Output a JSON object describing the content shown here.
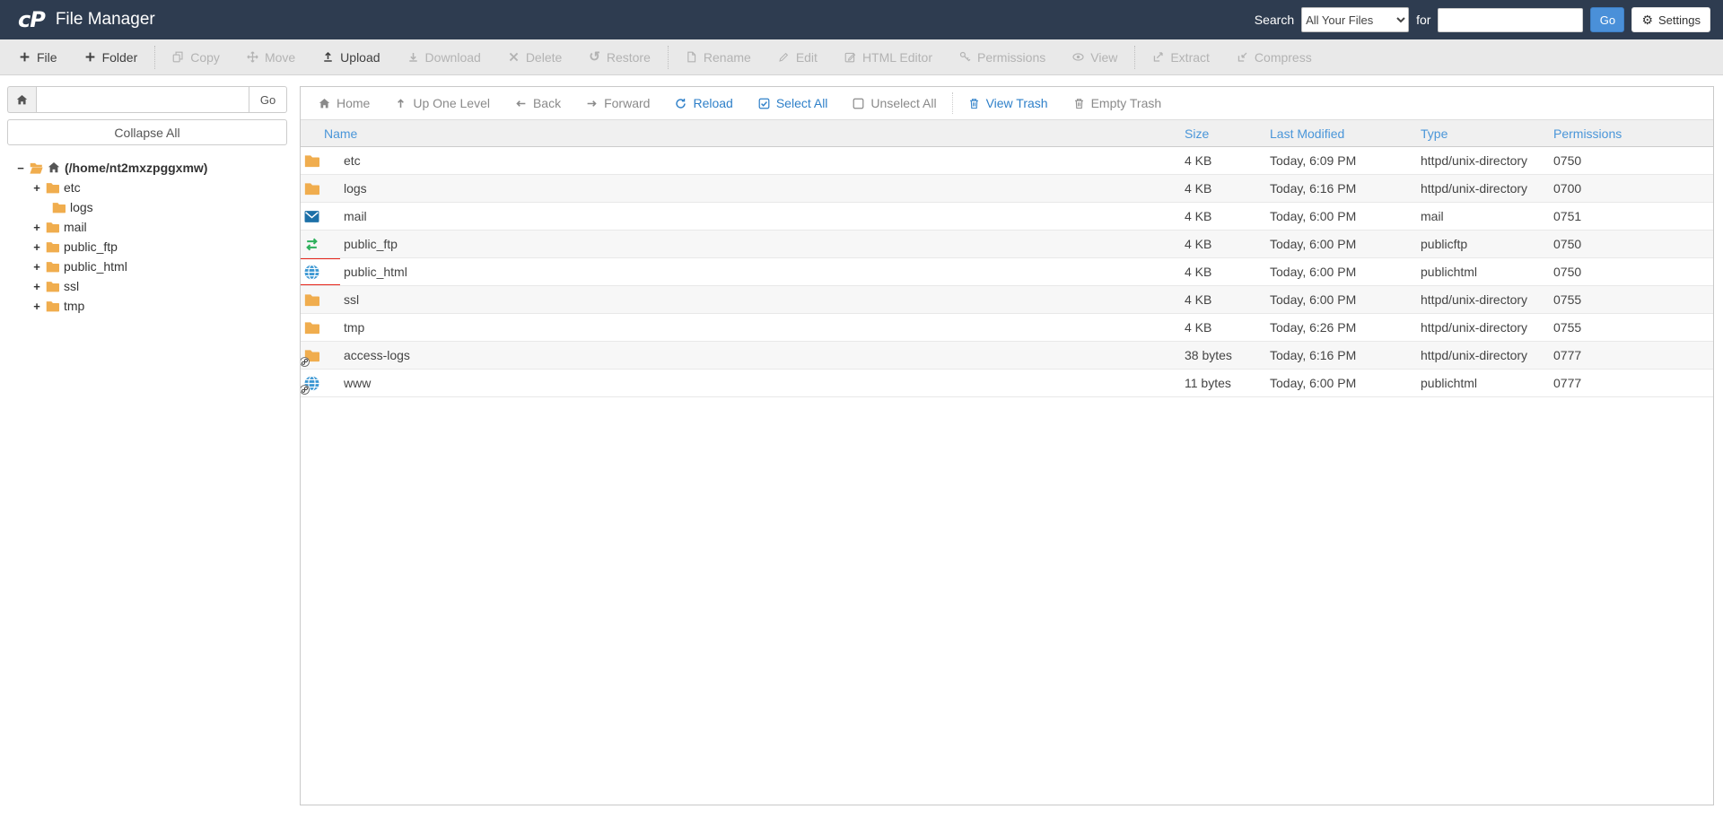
{
  "colors": {
    "header_bg": "#2e3c50",
    "accent_blue": "#2f80c9",
    "go_button_blue": "#4a90d9",
    "folder_orange": "#f0ad4e",
    "highlight_red": "#e62117",
    "table_header_blue": "#4a96d9"
  },
  "header": {
    "logo": "cP",
    "title": "File Manager",
    "search_label": "Search",
    "search_scope": "All Your Files",
    "for_label": "for",
    "search_value": "",
    "go_label": "Go",
    "settings_label": "Settings"
  },
  "toolbar": {
    "groups": [
      [
        {
          "label": "File",
          "icon": "plus",
          "enabled": true
        },
        {
          "label": "Folder",
          "icon": "plus",
          "enabled": true
        }
      ],
      [
        {
          "label": "Copy",
          "icon": "copy",
          "enabled": false
        },
        {
          "label": "Move",
          "icon": "move",
          "enabled": false
        },
        {
          "label": "Upload",
          "icon": "upload",
          "enabled": true
        },
        {
          "label": "Download",
          "icon": "download",
          "enabled": false
        },
        {
          "label": "Delete",
          "icon": "x",
          "enabled": false
        },
        {
          "label": "Restore",
          "icon": "u:↺",
          "enabled": false
        }
      ],
      [
        {
          "label": "Rename",
          "icon": "file",
          "enabled": false
        },
        {
          "label": "Edit",
          "icon": "pencil",
          "enabled": false
        },
        {
          "label": "HTML Editor",
          "icon": "pencil-sq",
          "enabled": false
        },
        {
          "label": "Permissions",
          "icon": "key",
          "enabled": false
        },
        {
          "label": "View",
          "icon": "eye",
          "enabled": false
        }
      ],
      [
        {
          "label": "Extract",
          "icon": "extract",
          "enabled": false
        },
        {
          "label": "Compress",
          "icon": "compress",
          "enabled": false
        }
      ]
    ]
  },
  "sidebar": {
    "path_value": "",
    "go_label": "Go",
    "collapse_all": "Collapse All",
    "root_label": "(/home/nt2mxzpggxmw)",
    "tree": [
      {
        "label": "etc",
        "toggle": "+",
        "indent": 1
      },
      {
        "label": "logs",
        "toggle": "",
        "indent": 2
      },
      {
        "label": "mail",
        "toggle": "+",
        "indent": 1
      },
      {
        "label": "public_ftp",
        "toggle": "+",
        "indent": 1
      },
      {
        "label": "public_html",
        "toggle": "+",
        "indent": 1
      },
      {
        "label": "ssl",
        "toggle": "+",
        "indent": 1
      },
      {
        "label": "tmp",
        "toggle": "+",
        "indent": 1
      }
    ]
  },
  "nav_toolbar": {
    "items": [
      {
        "label": "Home",
        "icon": "house",
        "style": "muted"
      },
      {
        "label": "Up One Level",
        "icon": "up",
        "style": "muted"
      },
      {
        "label": "Back",
        "icon": "left",
        "style": "muted"
      },
      {
        "label": "Forward",
        "icon": "right",
        "style": "muted"
      },
      {
        "label": "Reload",
        "icon": "reload",
        "style": "link"
      },
      {
        "label": "Select All",
        "icon": "check-sq",
        "style": "link"
      },
      {
        "label": "Unselect All",
        "icon": "empty-sq",
        "style": "muted"
      },
      {
        "sep": true
      },
      {
        "label": "View Trash",
        "icon": "trash",
        "style": "link"
      },
      {
        "label": "Empty Trash",
        "icon": "trash",
        "style": "muted"
      }
    ]
  },
  "file_table": {
    "headers": [
      "Name",
      "Size",
      "Last Modified",
      "Type",
      "Permissions"
    ],
    "rows": [
      {
        "name": "etc",
        "icon": "folder",
        "link": false,
        "size": "4 KB",
        "modified": "Today, 6:09 PM",
        "type": "httpd/unix-directory",
        "permissions": "0750",
        "highlighted": false
      },
      {
        "name": "logs",
        "icon": "folder",
        "link": false,
        "size": "4 KB",
        "modified": "Today, 6:16 PM",
        "type": "httpd/unix-directory",
        "permissions": "0700",
        "highlighted": false
      },
      {
        "name": "mail",
        "icon": "envelope",
        "link": false,
        "size": "4 KB",
        "modified": "Today, 6:00 PM",
        "type": "mail",
        "permissions": "0751",
        "highlighted": false
      },
      {
        "name": "public_ftp",
        "icon": "swap",
        "link": false,
        "size": "4 KB",
        "modified": "Today, 6:00 PM",
        "type": "publicftp",
        "permissions": "0750",
        "highlighted": false
      },
      {
        "name": "public_html",
        "icon": "globe",
        "link": false,
        "size": "4 KB",
        "modified": "Today, 6:00 PM",
        "type": "publichtml",
        "permissions": "0750",
        "highlighted": true
      },
      {
        "name": "ssl",
        "icon": "folder",
        "link": false,
        "size": "4 KB",
        "modified": "Today, 6:00 PM",
        "type": "httpd/unix-directory",
        "permissions": "0755",
        "highlighted": false
      },
      {
        "name": "tmp",
        "icon": "folder",
        "link": false,
        "size": "4 KB",
        "modified": "Today, 6:26 PM",
        "type": "httpd/unix-directory",
        "permissions": "0755",
        "highlighted": false
      },
      {
        "name": "access-logs",
        "icon": "folder",
        "link": true,
        "size": "38 bytes",
        "modified": "Today, 6:16 PM",
        "type": "httpd/unix-directory",
        "permissions": "0777",
        "highlighted": false
      },
      {
        "name": "www",
        "icon": "globe",
        "link": true,
        "size": "11 bytes",
        "modified": "Today, 6:00 PM",
        "type": "publichtml",
        "permissions": "0777",
        "highlighted": false
      }
    ]
  }
}
